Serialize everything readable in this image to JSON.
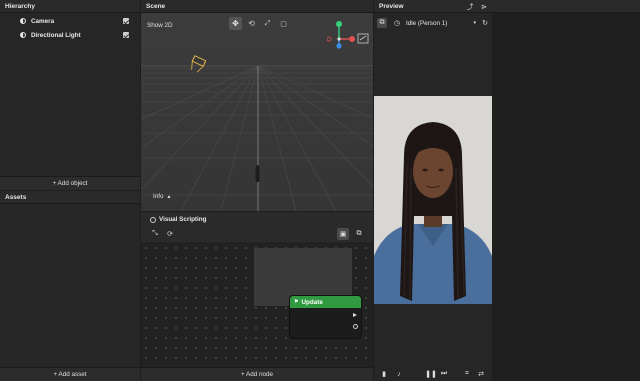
{
  "hierarchy": {
    "title": "Hierarchy",
    "items": [
      {
        "label": "Camera"
      },
      {
        "label": "Directional Light"
      }
    ],
    "add_object": "+ Add object"
  },
  "assets": {
    "title": "Assets",
    "add_asset": "+ Add asset"
  },
  "scene": {
    "title": "Scene",
    "show2d": "Show 2D",
    "info": "Info"
  },
  "visual_scripting": {
    "title": "Visual Scripting",
    "node_title": "Update",
    "add_node": "+ Add node"
  },
  "preview": {
    "title": "Preview",
    "animation_select": "Idle (Person 1)"
  },
  "colors": {
    "node_header": "#2f9a3f",
    "gizmo_y": "#37d07a",
    "gizmo_x": "#e05050",
    "gizmo_z": "#3a8ee6"
  }
}
